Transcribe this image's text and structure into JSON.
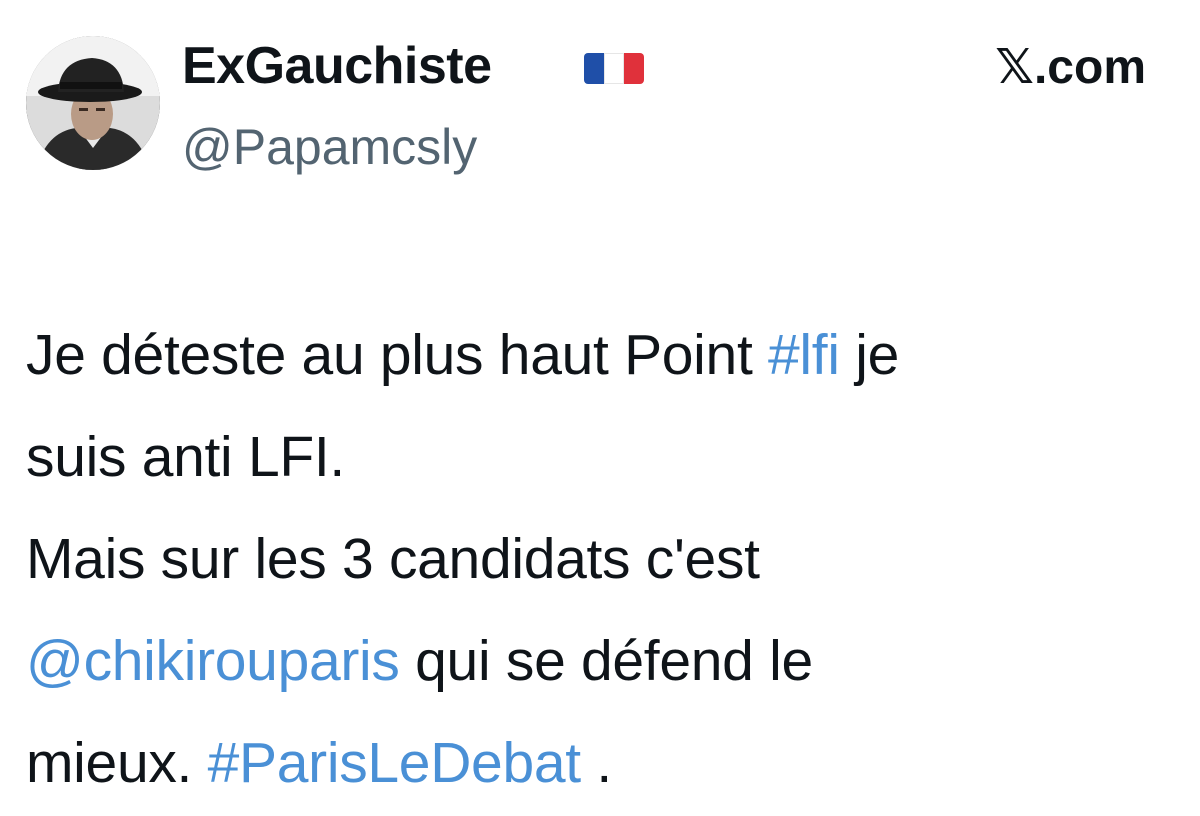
{
  "author": {
    "display_name": "ExGauchiste",
    "flag_emoji": "🇫🇷",
    "handle": "@Papamcsly",
    "avatar_icon": "profile-photo-man-in-fedora"
  },
  "brand": {
    "label": "𝕏.com"
  },
  "colors": {
    "link": "#4a90d6",
    "text": "#0f1419",
    "secondary": "#536471",
    "flag_blue": "#1f4fa8",
    "flag_white": "#ffffff",
    "flag_red": "#e0313b"
  },
  "tweet": {
    "lines": [
      [
        {
          "text": "Je déteste au plus haut Point ",
          "link": false
        },
        {
          "text": "#lfi",
          "link": true
        },
        {
          "text": " je",
          "link": false
        }
      ],
      [
        {
          "text": "suis anti LFI.",
          "link": false
        }
      ],
      [
        {
          "text": "Mais sur les 3 candidats c'est",
          "link": false
        }
      ],
      [
        {
          "text": "@chikirouparis",
          "link": true
        },
        {
          "text": " qui se défend le",
          "link": false
        }
      ],
      [
        {
          "text": "mieux. ",
          "link": false
        },
        {
          "text": "#ParisLeDebat",
          "link": true
        },
        {
          "text": " .",
          "link": false
        }
      ]
    ]
  }
}
